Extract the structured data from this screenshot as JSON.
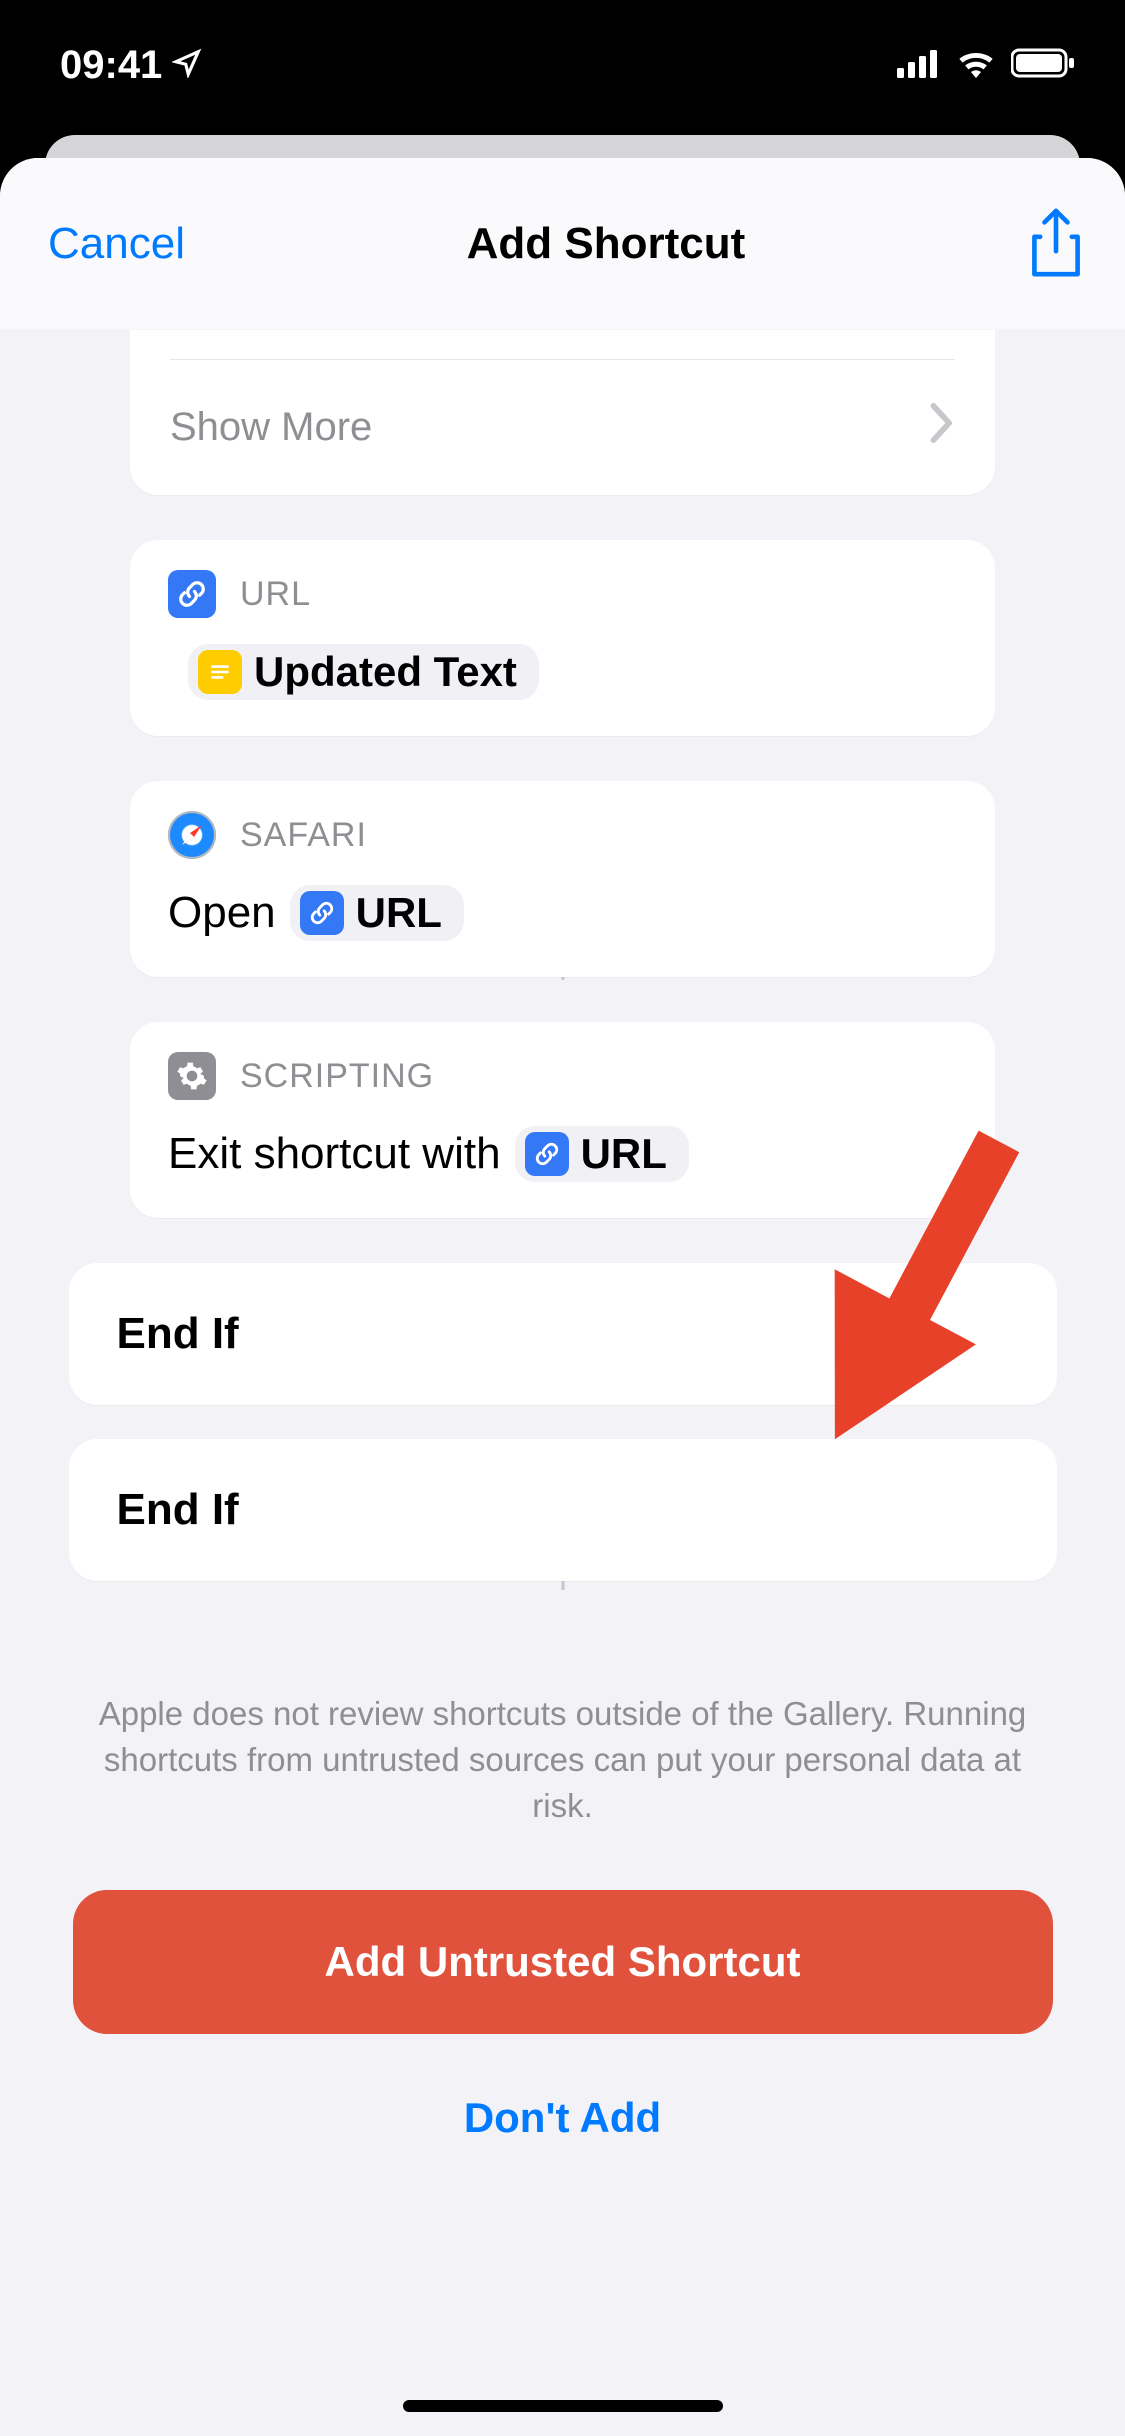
{
  "status": {
    "time": "09:41"
  },
  "header": {
    "cancel": "Cancel",
    "title": "Add Shortcut"
  },
  "showMore": {
    "label": "Show More"
  },
  "actions": {
    "url": {
      "header": "URL",
      "pill": "Updated Text"
    },
    "safari": {
      "header": "SAFARI",
      "prefix": "Open",
      "pill": "URL"
    },
    "scripting": {
      "header": "SCRIPTING",
      "prefix": "Exit shortcut with",
      "pill": "URL"
    },
    "endif1": "End If",
    "endif2": "End If"
  },
  "warning": "Apple does not review shortcuts outside of the Gallery. Running shortcuts from untrusted sources can put your personal data at risk.",
  "buttons": {
    "add": "Add Untrusted Shortcut",
    "dontAdd": "Don't Add"
  }
}
